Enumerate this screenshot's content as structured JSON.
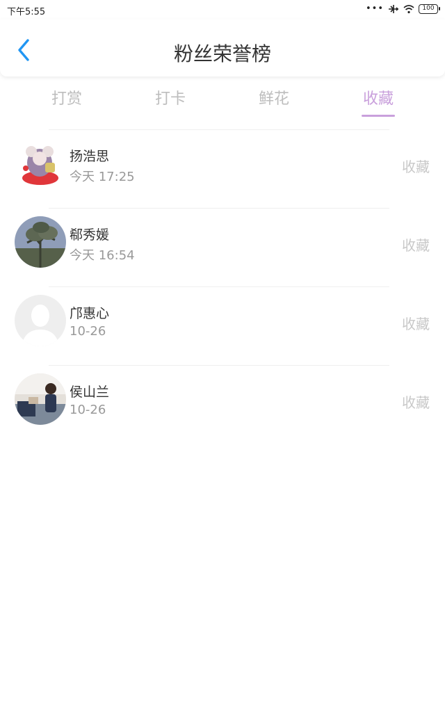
{
  "status_bar": {
    "time": "下午5:55",
    "dots": "•••",
    "battery": "100"
  },
  "header": {
    "title": "粉丝荣誉榜"
  },
  "tabs": [
    {
      "label": "打赏"
    },
    {
      "label": "打卡"
    },
    {
      "label": "鲜花"
    },
    {
      "label": "收藏"
    }
  ],
  "active_tab": "收藏",
  "colors": {
    "accent": "#c9a0dc",
    "back": "#2196f3",
    "muted": "#bdbdbd"
  },
  "fans": [
    {
      "name": "扬浩思",
      "time": "今天 17:25",
      "action": "收藏"
    },
    {
      "name": "郗秀媛",
      "time": "今天 16:54",
      "action": "收藏"
    },
    {
      "name": "邝惠心",
      "time": "10-26",
      "action": "收藏"
    },
    {
      "name": "侯山兰",
      "time": "10-26",
      "action": "收藏"
    }
  ]
}
